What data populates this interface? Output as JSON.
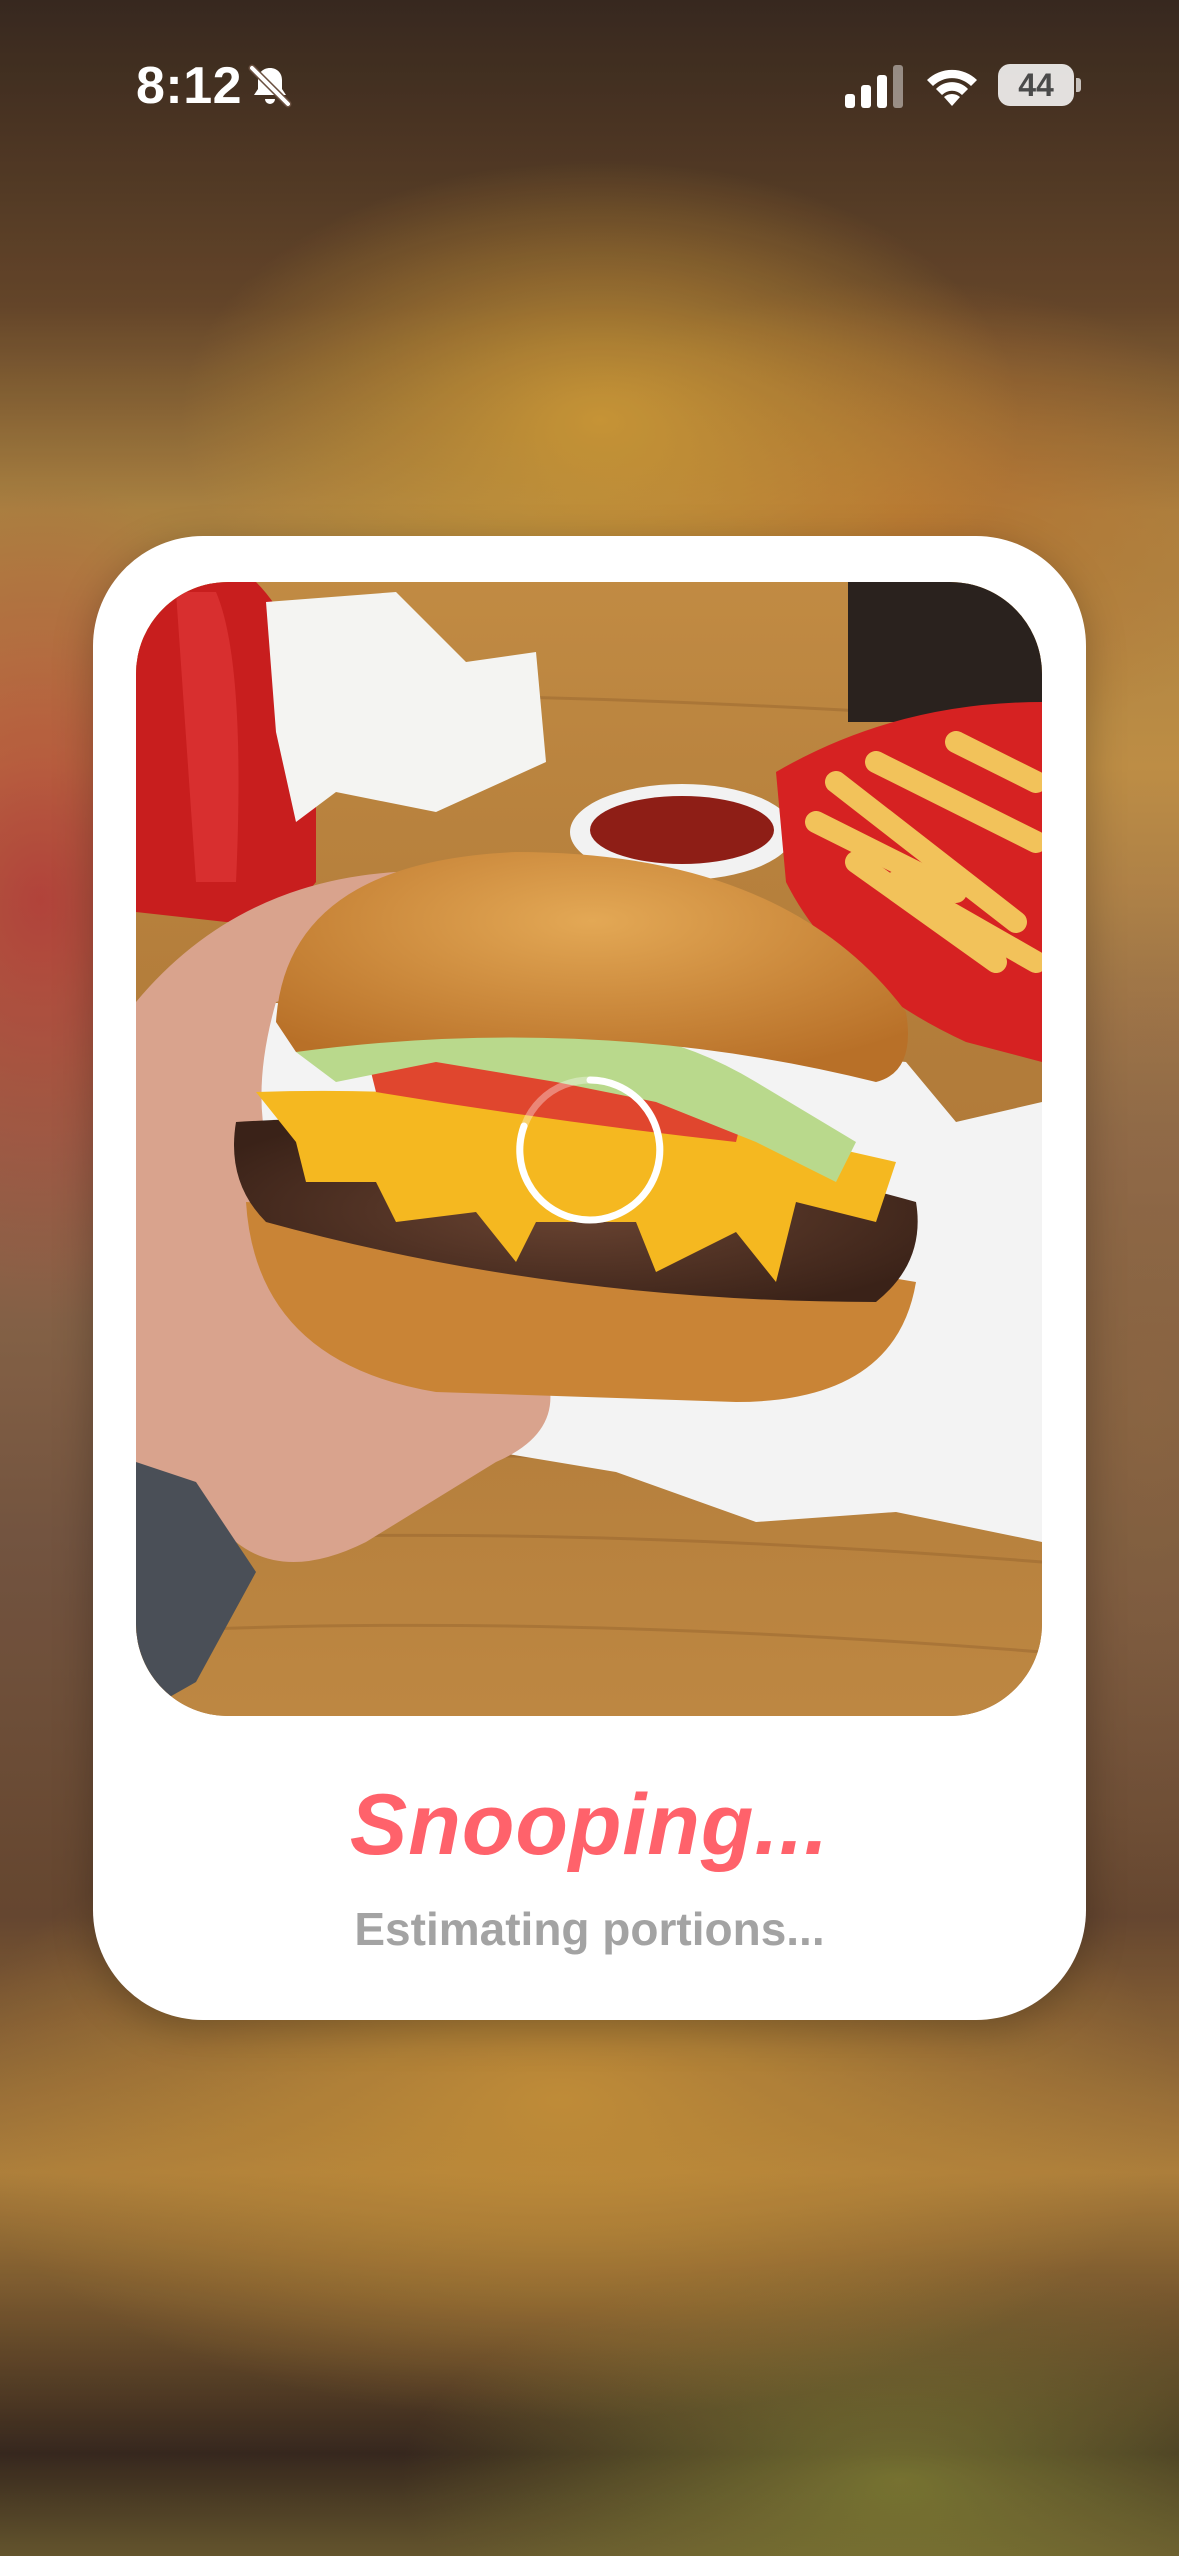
{
  "status_bar": {
    "time": "8:12",
    "battery": "44",
    "icons": [
      "bell-slash-icon",
      "cellular-signal-icon",
      "wifi-icon",
      "battery-icon"
    ]
  },
  "loader": {
    "title": "Snooping...",
    "subtitle": "Estimating portions...",
    "accent_color": "#ff626b",
    "subtitle_color": "#a3a3a3",
    "photo_subject": "food photo",
    "spinner_icon": "loading-spinner-icon"
  }
}
